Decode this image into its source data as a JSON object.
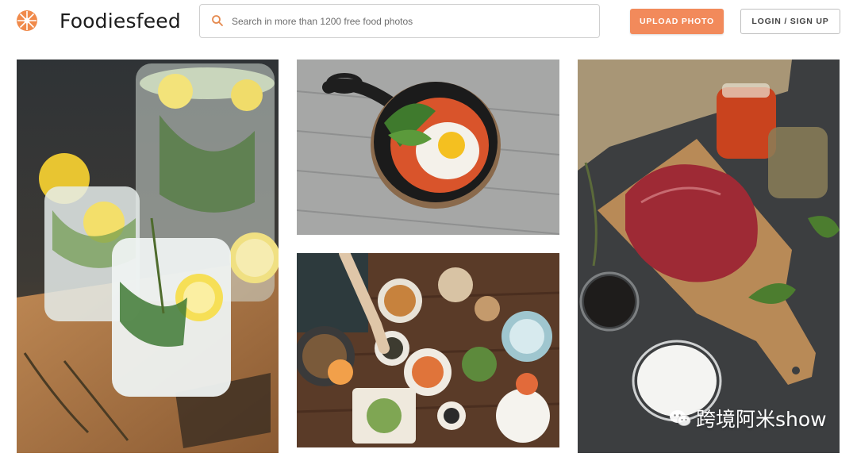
{
  "header": {
    "brand": "Foodiesfeed",
    "search_placeholder": "Search in more than 1200 free food photos",
    "upload_label": "UPLOAD PHOTO",
    "login_label": "LOGIN / SIGN UP"
  },
  "photos": [
    {
      "subject": "lemon gin tonic drinks with thyme on a wooden board"
    },
    {
      "subject": "fried egg with spinach in a cast iron skillet"
    },
    {
      "subject": "table spread of dishes seen from above"
    },
    {
      "subject": "raw steak on a cutting board with spices"
    }
  ],
  "watermark": {
    "text": "跨境阿米show"
  },
  "colors": {
    "accent": "#f28a5b",
    "logo": "#f08a4b",
    "border": "#cfcfcf"
  }
}
